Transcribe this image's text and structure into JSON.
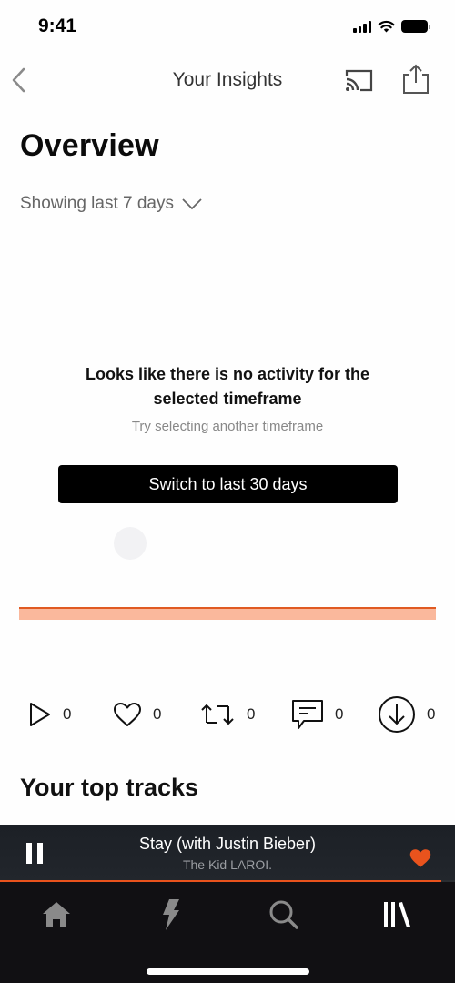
{
  "status_bar": {
    "time": "9:41"
  },
  "nav": {
    "title": "Your Insights",
    "back_icon": "chevron-left-icon",
    "cast_icon": "cast-icon",
    "share_icon": "share-icon"
  },
  "overview": {
    "title": "Overview",
    "timeframe_label": "Showing last 7 days"
  },
  "empty_state": {
    "title": "Looks like there is no activity for the selected timeframe",
    "subtitle": "Try selecting another timeframe",
    "button_label": "Switch to last 30 days"
  },
  "colors": {
    "accent": "#e9531d",
    "chart_fill": "#fab89c",
    "chart_line": "#e05a22"
  },
  "stats": [
    {
      "icon": "play-icon",
      "label": "Plays",
      "count": "0"
    },
    {
      "icon": "heart-icon",
      "label": "Likes",
      "count": "0"
    },
    {
      "icon": "repost-icon",
      "label": "Reposts",
      "count": "0"
    },
    {
      "icon": "comment-icon",
      "label": "Comments",
      "count": "0"
    },
    {
      "icon": "download-icon",
      "label": "Downloads",
      "count": "0"
    }
  ],
  "top_tracks": {
    "title": "Your top tracks"
  },
  "mini_player": {
    "track_title": "Stay (with Justin Bieber)",
    "artist": "The Kid LAROI.",
    "progress_fraction": 0.97,
    "liked": true
  },
  "tab_bar": {
    "tabs": [
      {
        "icon": "home-icon",
        "name": "Home",
        "active": false
      },
      {
        "icon": "lightning-icon",
        "name": "Stream",
        "active": false
      },
      {
        "icon": "search-icon",
        "name": "Search",
        "active": false
      },
      {
        "icon": "library-icon",
        "name": "Library",
        "active": true
      }
    ]
  }
}
